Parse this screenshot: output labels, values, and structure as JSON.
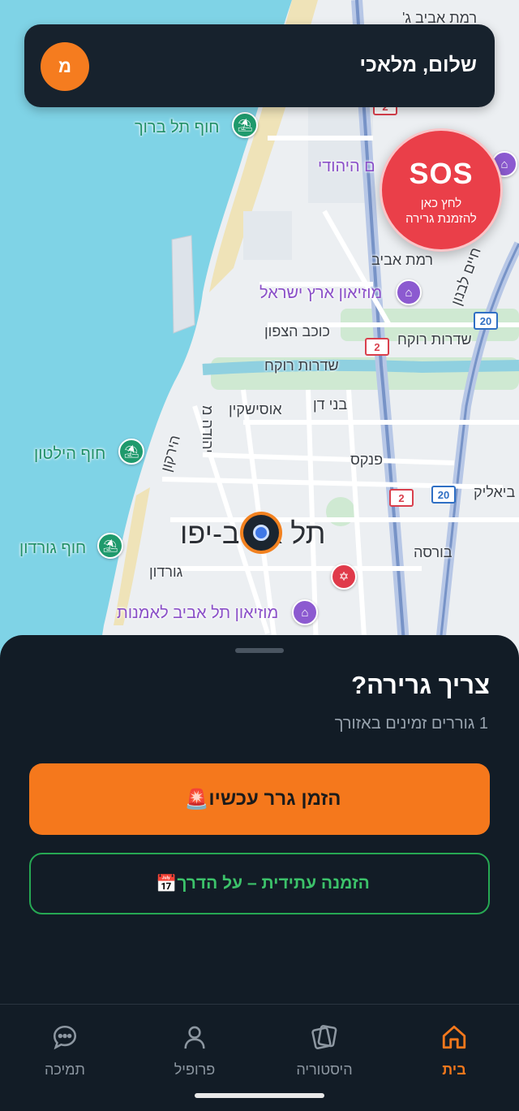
{
  "header": {
    "greeting": "שלום, מלאכי",
    "avatar_initial": "מ"
  },
  "sos": {
    "title": "SOS",
    "line1": "לחץ כאן",
    "line2": "להזמנת גרירה"
  },
  "map": {
    "city": "תל אביב-יפו",
    "labels": {
      "ramat_aviv_g": "רמת אביב ג'",
      "beach_tel_baruch": "חוף תל ברוך",
      "jewish_museum": "ם היהודי",
      "ramat_aviv": "רמת אביב",
      "haim_levanon": "חיים לבנון",
      "eretz_israel_museum": "מוזיאון ארץ ישראל",
      "kochav_hatzafon": "כוכב הצפון",
      "rokach_1": "שדרות רוקח",
      "rokach_2": "שדרות רוקח",
      "bnei_dan": "בני דן",
      "ussishkin": "אוסישקין",
      "yehuda_maccabi": "יהודה מ",
      "hayarkon": "הירקון",
      "beach_hilton": "חוף הילטון",
      "pinkas": "פנקס",
      "bialik": "ביאליק",
      "beach_gordon": "חוף גורדון",
      "gordon": "גורדון",
      "bursa": "בורסה",
      "tlv_art_museum": "מוזיאון תל אביב לאמנות"
    },
    "road_badges": [
      "2",
      "2",
      "2",
      "20",
      "20"
    ]
  },
  "sheet": {
    "title": "צריך גרירה?",
    "subtitle": "1 גוררים זמינים באזורך",
    "order_now_label": "הזמן גרר עכשיו",
    "order_now_emoji": "🚨",
    "order_future_label": "הזמנה עתידית – על הדרך",
    "order_future_emoji": "📅"
  },
  "nav": {
    "items": [
      {
        "label": "בית",
        "icon": "home-icon",
        "active": true
      },
      {
        "label": "היסטוריה",
        "icon": "history-icon",
        "active": false
      },
      {
        "label": "פרופיל",
        "icon": "profile-icon",
        "active": false
      },
      {
        "label": "תמיכה",
        "icon": "support-chat-icon",
        "active": false
      }
    ]
  },
  "colors": {
    "accent": "#f5781c",
    "sos": "#ea3f49",
    "success": "#26a853",
    "background": "#121c26"
  }
}
